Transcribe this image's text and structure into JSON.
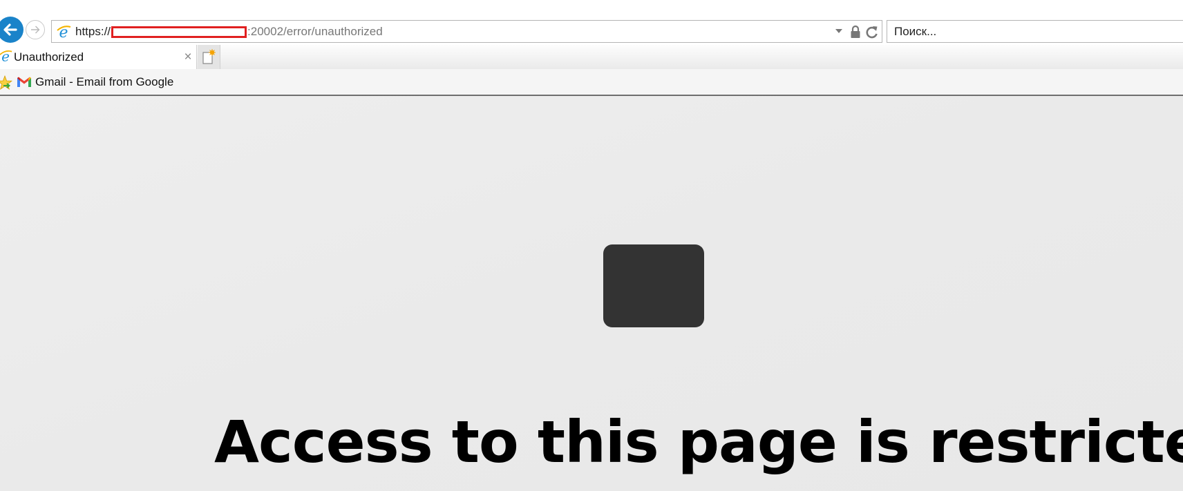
{
  "browser": {
    "address_bar": {
      "scheme": "https://",
      "redacted": true,
      "suffix": ":20002/error/unauthorized",
      "icon": "ie-icon"
    },
    "search": {
      "placeholder": "Поиск..."
    },
    "tabs": [
      {
        "title": "Unauthorized",
        "active": true,
        "icon": "ie-icon"
      }
    ],
    "favorites": [
      {
        "label": "Gmail - Email from Google",
        "icon": "gmail-icon"
      }
    ],
    "icons": {
      "back": "arrow-left-icon",
      "forward": "arrow-right-icon",
      "lock": "lock-icon",
      "refresh": "refresh-icon",
      "dropdown": "chevron-down-icon",
      "new_tab": "new-tab-icon",
      "close": "×"
    },
    "colors": {
      "back_button": "#1a83c9",
      "redaction": "#e02020"
    }
  },
  "page": {
    "heading": "Access to this page is restricted",
    "box_color": "#333333",
    "background": "#ebebeb"
  }
}
